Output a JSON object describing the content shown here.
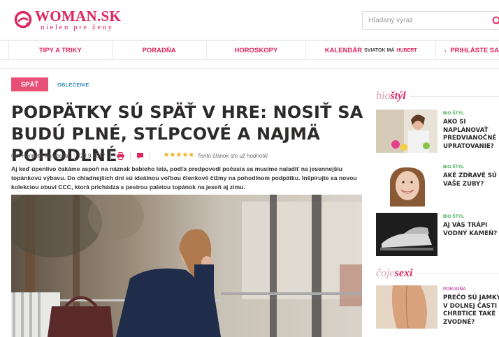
{
  "brand": {
    "name": "WOMAN.SK",
    "tagline": "nielen pre ženy",
    "color": "#e0245e"
  },
  "search": {
    "placeholder": "Hľadaný výraz",
    "icon": "search-icon"
  },
  "nav": {
    "items": [
      {
        "label": "TIPY A TRIKY"
      },
      {
        "label": "PORADŇA"
      },
      {
        "label": "HOROSKOPY"
      },
      {
        "label": "KALENDÁR",
        "sub1": "SVIATOK MÁ",
        "sub2": "HUBERT"
      },
      {
        "label": "PRIHLÁSTE SA",
        "icon": "user-icon"
      }
    ]
  },
  "article": {
    "back_label": "SPÄŤ",
    "category": "OBLEČENIE",
    "title": "PODPÄTKY SÚ SPÄŤ V HRE: NOSIŤ SA BUDÚ PLNÉ, STĹPCOVÉ A NAJMÄ POHODLNÉ",
    "author": "Od: Henrieta Karabova",
    "date": "29.9.2017",
    "rating_stars": 5,
    "rating_note": "Tento článok ste už hodnotili",
    "lead": "Aj keď úpenlivo čakáme aspoň na náznak babieho leta, podľa predpovedí počasia sa musíme naladiť na jesennejšiu topánkovú výbavu. Do chladnejších dní sú ideálnou voľbou členkové čižmy na pohodlnom podpätku. Inšpirujte sa novou kolekciou obuvi CCC, ktorá prichádza s pestrou paletou topánok na jeseň aj zimu.",
    "accent": "#e84f77"
  },
  "sidebar": {
    "section1": {
      "prefix": "bio",
      "word": "štýl"
    },
    "section2": {
      "prefix": "čoje",
      "word": "sexi"
    },
    "cards": [
      {
        "category": "BIO ŠTÝL",
        "title": "AKO SI NAPLÁNOVAŤ PREDVIANOČNÉ UPRATOVANIE?"
      },
      {
        "category": "BIO ŠTÝL",
        "title": "AKÉ ZDRAVÉ SÚ VAŠE ZUBY?"
      },
      {
        "category": "BIO ŠTÝL",
        "title": "AJ VÁS TRÁPI VODNÝ KAMEŇ?"
      },
      {
        "category": "PORADŇA",
        "title": "PREČO SÚ JAMKY V DOLNEJ ČASTI CHRBTICE TAKÉ ZVODNÉ?"
      }
    ]
  }
}
